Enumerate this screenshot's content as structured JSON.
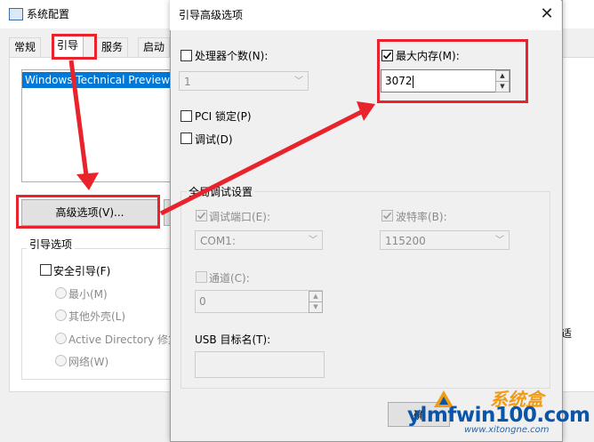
{
  "back_window": {
    "title": "系统配置",
    "tabs": [
      "常规",
      "引导",
      "服务",
      "启动"
    ],
    "os_list_selected": "Windows Technical Preview",
    "advanced_button": "高级选项(V)...",
    "boot_options_group": "引导选项",
    "safe_boot": "安全引导(F)",
    "radio_minimal": "最小(M)",
    "radio_alt_shell": "其他外壳(L)",
    "radio_ad_repair": "Active Directory 修复",
    "radio_network": "网络(W)",
    "side_partial": "适"
  },
  "dialog": {
    "title": "引导高级选项",
    "close_glyph": "✕",
    "num_processors_label": "处理器个数(N):",
    "num_processors_value": "1",
    "max_memory_label": "最大内存(M):",
    "max_memory_value": "3072",
    "max_memory_checked": true,
    "pci_lock_label": "PCI 锁定(P)",
    "debug_label": "调试(D)",
    "global_debug_group": "全局调试设置",
    "debug_port_label": "调试端口(E):",
    "debug_port_value": "COM1:",
    "baud_rate_label": "波特率(B):",
    "baud_rate_value": "115200",
    "channel_label": "通道(C):",
    "channel_value": "0",
    "usb_target_label": "USB 目标名(T):",
    "ok_button": "确"
  },
  "watermark": {
    "main": "ylmfwin100.com",
    "sub": "www.xitongne.com",
    "cn": "系统盒"
  },
  "colors": {
    "highlight": "#e8232b",
    "selection": "#0078d7",
    "watermark_blue": "#0b55a8",
    "watermark_orange": "#f29b12"
  }
}
